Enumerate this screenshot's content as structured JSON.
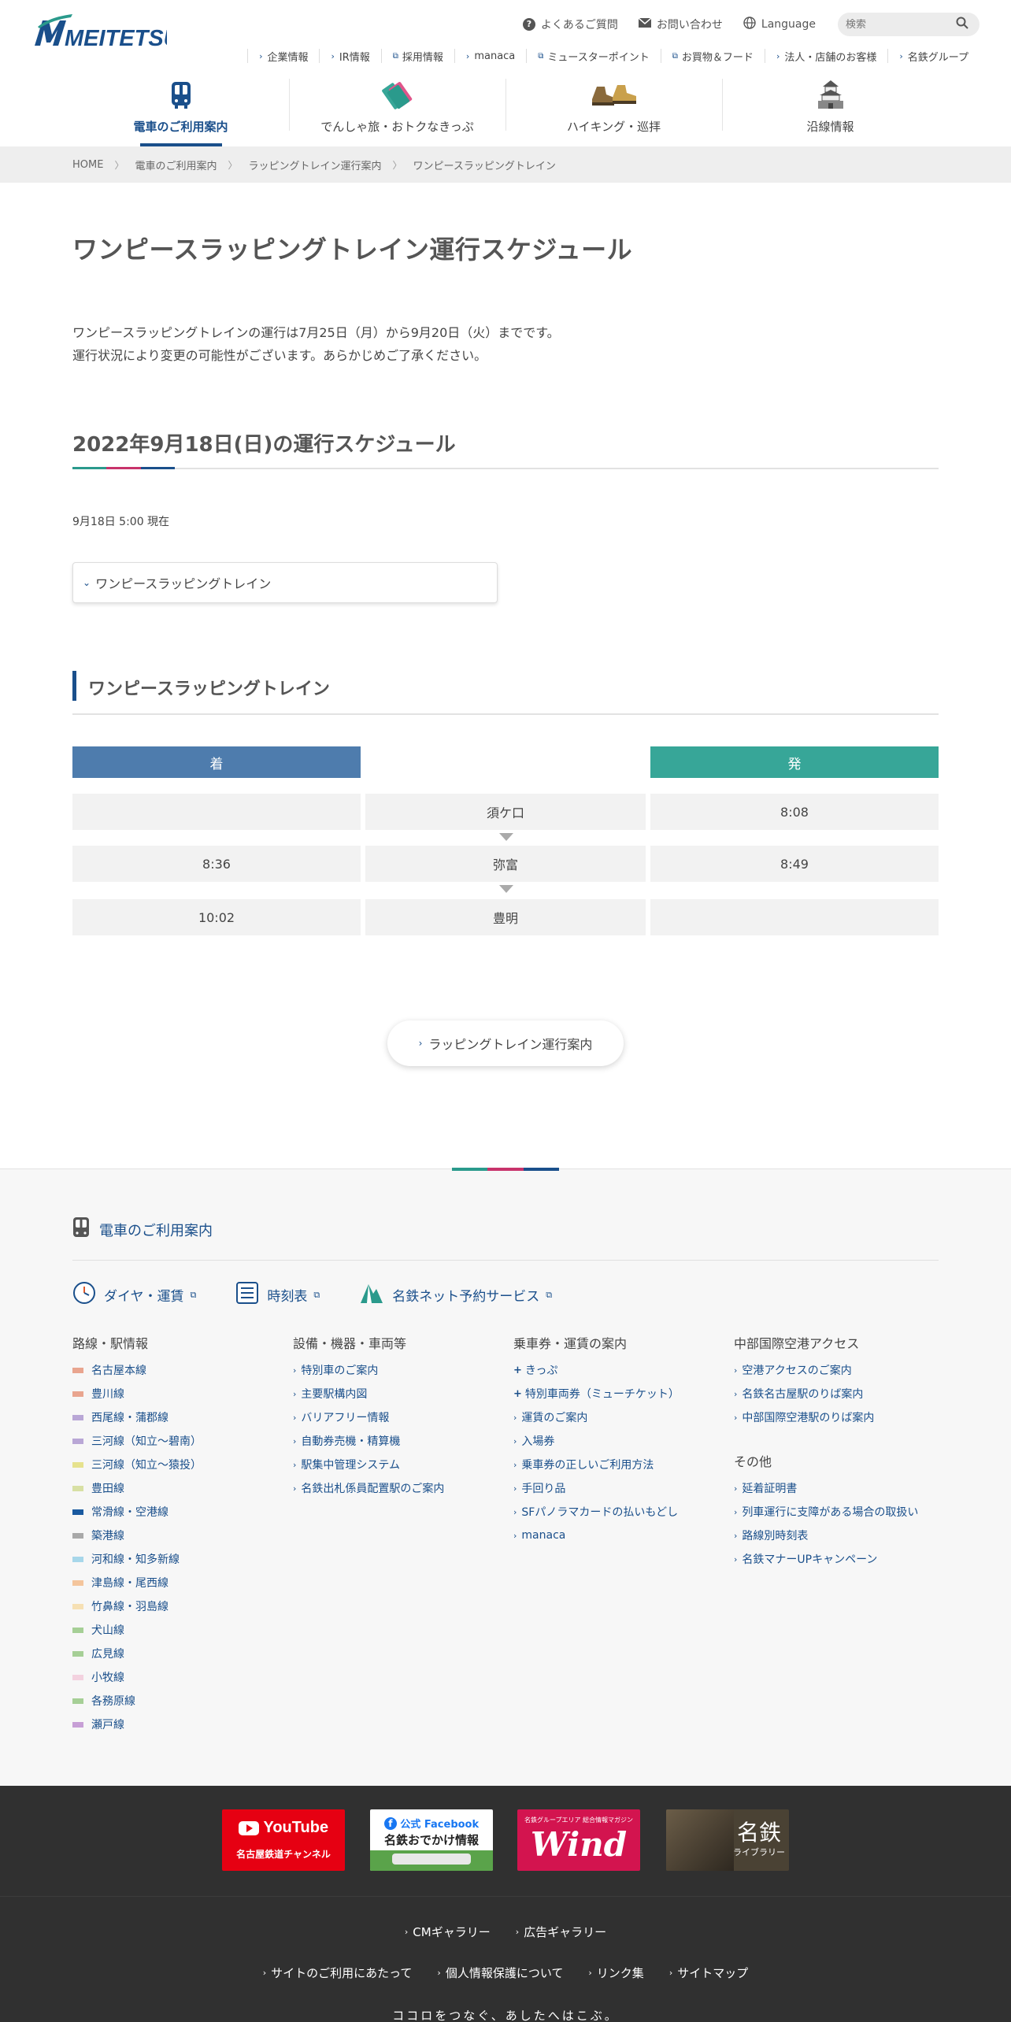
{
  "header": {
    "logo_text": "MEITETSU",
    "util": [
      {
        "label": "よくあるご質問"
      },
      {
        "label": "お問い合わせ"
      },
      {
        "label": "Language"
      }
    ],
    "search_placeholder": "検索",
    "subnav": [
      {
        "label": "企業情報"
      },
      {
        "label": "IR情報"
      },
      {
        "label": "採用情報"
      },
      {
        "label": "manaca"
      },
      {
        "label": "ミュースターポイント"
      },
      {
        "label": "お買物＆フード"
      },
      {
        "label": "法人・店舗のお客様"
      },
      {
        "label": "名鉄グループ"
      }
    ],
    "mainnav": [
      {
        "label": "電車のご利用案内"
      },
      {
        "label": "でんしゃ旅・おトクなきっぷ"
      },
      {
        "label": "ハイキング・巡拝"
      },
      {
        "label": "沿線情報"
      }
    ]
  },
  "breadcrumb": [
    "HOME",
    "電車のご利用案内",
    "ラッピングトレイン運行案内",
    "ワンピースラッピングトレイン"
  ],
  "main": {
    "title": "ワンピースラッピングトレイン運行スケジュール",
    "intro_line1": "ワンピースラッピングトレインの運行は7月25日（月）から9月20日（火）までです。",
    "intro_line2": "運行状況により変更の可能性がございます。あらかじめご了承ください。",
    "section_title": "2022年9月18日(日)の運行スケジュール",
    "as_of": "9月18日 5:00 現在",
    "dropdown_label": "ワンピースラッピングトレイン",
    "subsection_title": "ワンピースラッピングトレイン",
    "timetable": {
      "arrive_header": "着",
      "depart_header": "発",
      "rows": [
        {
          "arrive": "",
          "station": "須ケ口",
          "depart": "8:08"
        },
        {
          "arrive": "8:36",
          "station": "弥富",
          "depart": "8:49"
        },
        {
          "arrive": "10:02",
          "station": "豊明",
          "depart": ""
        }
      ]
    },
    "pill_button": "ラッピングトレイン運行案内"
  },
  "footer": {
    "title": "電車のご利用案内",
    "links": [
      {
        "label": "ダイヤ・運賃"
      },
      {
        "label": "時刻表"
      },
      {
        "label": "名鉄ネット予約サービス"
      }
    ],
    "col1": {
      "heading": "路線・駅情報",
      "items": [
        {
          "label": "名古屋本線",
          "color": "#e9a58f"
        },
        {
          "label": "豊川線",
          "color": "#e9a58f"
        },
        {
          "label": "西尾線・蒲郡線",
          "color": "#b9a7d6"
        },
        {
          "label": "三河線（知立〜碧南）",
          "color": "#b9a7d6"
        },
        {
          "label": "三河線（知立〜猿投）",
          "color": "#e6e28d"
        },
        {
          "label": "豊田線",
          "color": "#d8e0a4"
        },
        {
          "label": "常滑線・空港線",
          "color": "#1a5aa0"
        },
        {
          "label": "築港線",
          "color": "#a9a9a9"
        },
        {
          "label": "河和線・知多新線",
          "color": "#a7d7ea"
        },
        {
          "label": "津島線・尾西線",
          "color": "#f4c59c"
        },
        {
          "label": "竹鼻線・羽島線",
          "color": "#f6e0b4"
        },
        {
          "label": "犬山線",
          "color": "#a6cf96"
        },
        {
          "label": "広見線",
          "color": "#a6cf96"
        },
        {
          "label": "小牧線",
          "color": "#f3d2df"
        },
        {
          "label": "各務原線",
          "color": "#a6cf96"
        },
        {
          "label": "瀬戸線",
          "color": "#c79fd6"
        }
      ]
    },
    "col2": {
      "heading": "設備・機器・車両等",
      "items": [
        {
          "label": "特別車のご案内"
        },
        {
          "label": "主要駅構内図"
        },
        {
          "label": "バリアフリー情報"
        },
        {
          "label": "自動券売機・精算機"
        },
        {
          "label": "駅集中管理システム"
        },
        {
          "label": "名鉄出札係員配置駅のご案内"
        }
      ]
    },
    "col3": {
      "heading": "乗車券・運賃の案内",
      "items": [
        {
          "label": "きっぷ",
          "type": "plus"
        },
        {
          "label": "特別車両券（ミューチケット）",
          "type": "plus"
        },
        {
          "label": "運賃のご案内",
          "type": "chev"
        },
        {
          "label": "入場券",
          "type": "chev"
        },
        {
          "label": "乗車券の正しいご利用方法",
          "type": "chev"
        },
        {
          "label": "手回り品",
          "type": "chev"
        },
        {
          "label": "SFパノラマカードの払いもどし",
          "type": "chev"
        },
        {
          "label": "manaca",
          "type": "chev"
        }
      ]
    },
    "col4": {
      "heading": "中部国際空港アクセス",
      "items": [
        {
          "label": "空港アクセスのご案内"
        },
        {
          "label": "名鉄名古屋駅のりば案内"
        },
        {
          "label": "中部国際空港駅のりば案内"
        }
      ],
      "heading2": "その他",
      "items2": [
        {
          "label": "延着証明書"
        },
        {
          "label": "列車運行に支障がある場合の取扱い"
        },
        {
          "label": "路線別時刻表"
        },
        {
          "label": "名鉄マナーUPキャンペーン"
        }
      ]
    }
  },
  "banners": {
    "youtube_title": "YouTube",
    "youtube_sub": "名古屋鉄道チャンネル",
    "facebook_title": "公式 Facebook",
    "facebook_sub": "名鉄おでかけ情報",
    "wind_sub": "名鉄グループエリア 総合情報マガジン",
    "wind_title": "Wind",
    "library_title": "名鉄",
    "library_sub": "ライブラリー"
  },
  "bottom": {
    "row1": [
      {
        "label": "CMギャラリー"
      },
      {
        "label": "広告ギャラリー"
      }
    ],
    "row2": [
      {
        "label": "サイトのご利用にあたって"
      },
      {
        "label": "個人情報保護について"
      },
      {
        "label": "リンク集"
      },
      {
        "label": "サイトマップ"
      }
    ],
    "tagline": "ココロをつなぐ、あしたへはこぶ。"
  },
  "colors": {
    "brand_blue": "#1a4f8b",
    "arrive_blue": "#4e7cad",
    "depart_teal": "#37a698",
    "accent_teal": "#2a9a8c",
    "accent_pink": "#c8336b",
    "accent_navy": "#1a4f8b"
  }
}
